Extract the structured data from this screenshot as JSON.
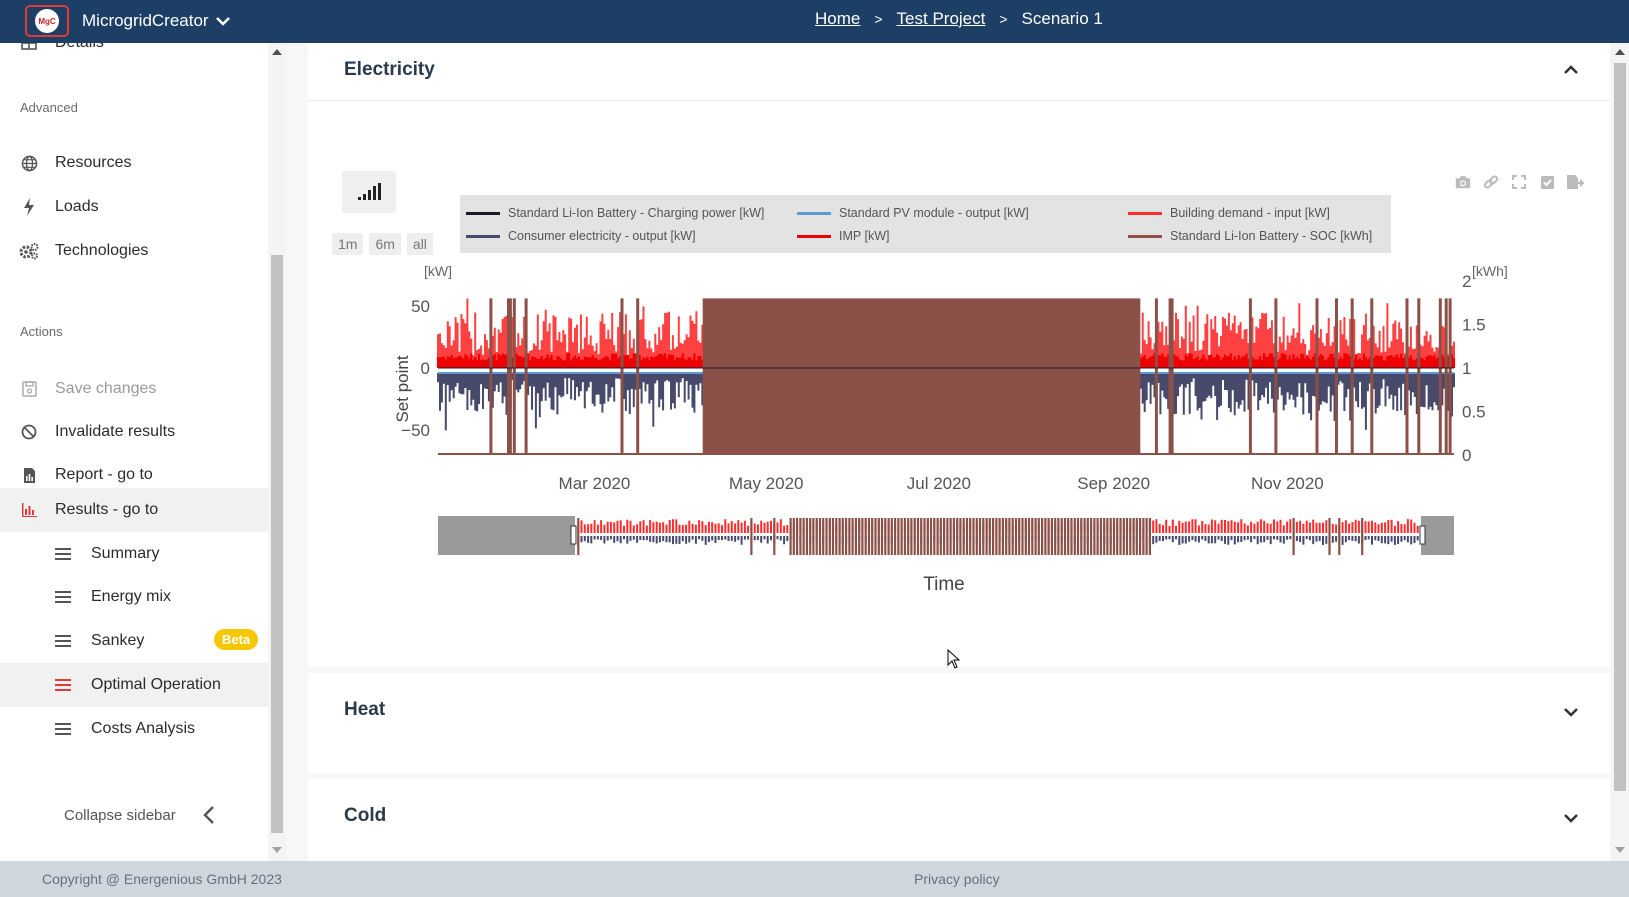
{
  "app": {
    "name": "MicrogridCreator",
    "logo_text": "MgC"
  },
  "breadcrumb": {
    "home": "Home",
    "project": "Test Project",
    "scenario": "Scenario 1"
  },
  "sidebar": {
    "partial_top_item": "Details",
    "section_advanced": "Advanced",
    "advanced_items": [
      {
        "label": "Resources",
        "icon": "globe-icon"
      },
      {
        "label": "Loads",
        "icon": "bolt-icon"
      },
      {
        "label": "Technologies",
        "icon": "gears-icon"
      }
    ],
    "section_actions": "Actions",
    "action_items": [
      {
        "label": "Save changes",
        "icon": "save-icon",
        "disabled": true
      },
      {
        "label": "Invalidate results",
        "icon": "ban-icon"
      },
      {
        "label": "Report - go to",
        "icon": "report-icon"
      },
      {
        "label": "Results - go to",
        "icon": "bar-chart-icon",
        "active": true
      }
    ],
    "results_sub_items": [
      {
        "label": "Summary"
      },
      {
        "label": "Energy mix"
      },
      {
        "label": "Sankey",
        "badge": "Beta"
      },
      {
        "label": "Optimal Operation",
        "active": true
      },
      {
        "label": "Costs Analysis"
      }
    ],
    "collapse_label": "Collapse sidebar"
  },
  "panels": {
    "electricity": "Electricity",
    "heat": "Heat",
    "cold": "Cold"
  },
  "range_buttons": [
    "1m",
    "6m",
    "all"
  ],
  "colors": {
    "topbar": "#1d3f66",
    "accent_red": "#e03a3a",
    "charging": "#1a1a2e",
    "pv": "#5b9bd5",
    "demand": "#ff2d2d",
    "consumer": "#474a6b",
    "imp": "#ee0000",
    "soc": "#8b5148"
  },
  "chart_data": {
    "type": "line",
    "title": "",
    "xlabel": "Time",
    "ylabel": "Set point",
    "y_unit_left": "[kW]",
    "y_unit_right": "[kWh]",
    "ylim_left": [
      -70,
      70
    ],
    "ylim_right": [
      0,
      2
    ],
    "yticks_left": [
      "50",
      "0",
      "−50"
    ],
    "yticks_right": [
      "2",
      "1.5",
      "1",
      "0.5",
      "0"
    ],
    "xticks": [
      "Mar 2020",
      "May 2020",
      "Jul 2020",
      "Sep 2020",
      "Nov 2020"
    ],
    "legend_position": "top",
    "range_slider": true,
    "series": [
      {
        "name": "Standard Li-Ion Battery - Charging power [kW]",
        "axis": "left",
        "approx_range": [
          0,
          0
        ]
      },
      {
        "name": "Standard PV module - output [kW]",
        "axis": "left",
        "approx_range": [
          -5,
          0
        ]
      },
      {
        "name": "Building demand - input [kW]",
        "axis": "left",
        "approx_range": [
          0,
          60
        ]
      },
      {
        "name": "Consumer electricity - output [kW]",
        "axis": "left",
        "approx_range": [
          -60,
          0
        ]
      },
      {
        "name": "IMP [kW]",
        "axis": "left",
        "approx_range": [
          0,
          15
        ]
      },
      {
        "name": "Standard Li-Ion Battery - SOC [kWh]",
        "axis": "right",
        "approx_range": [
          0,
          1.8
        ]
      }
    ]
  },
  "footer": {
    "copyright": "Copyright @ Energenious GmbH 2023",
    "privacy": "Privacy policy"
  }
}
